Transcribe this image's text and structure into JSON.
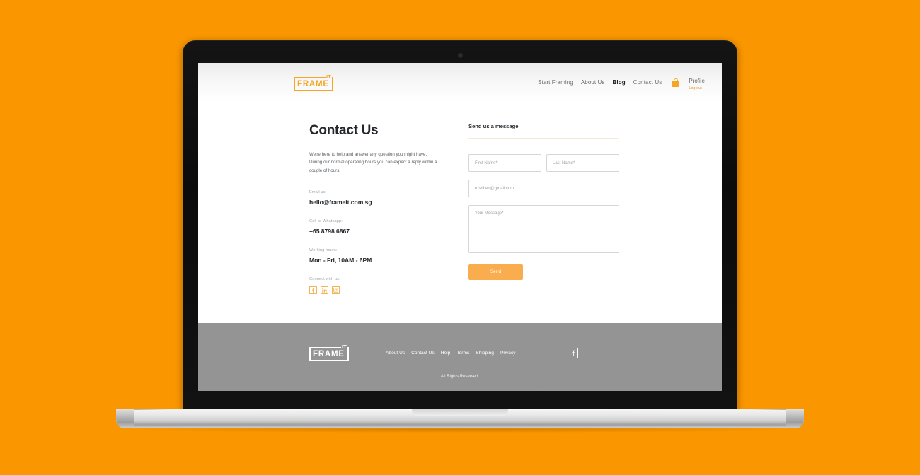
{
  "header": {
    "logo": {
      "word": "FRAME",
      "superscript": "IT"
    },
    "nav": [
      {
        "label": "Start Framing",
        "active": false
      },
      {
        "label": "About Us",
        "active": false
      },
      {
        "label": "Blog",
        "active": true
      },
      {
        "label": "Contact Us",
        "active": false
      }
    ],
    "cart_icon": "shopping-bag-icon",
    "profile": {
      "label": "Profile",
      "logout": "Log out"
    }
  },
  "contact": {
    "title": "Contact Us",
    "intro": "We're here to help and answer any question you might have. During our normal operating hours you can expect a reply within a couple of hours.",
    "email_label": "Email us:",
    "email_value": "hello@frameit.com.sg",
    "phone_label": "Call or Whatsapp:",
    "phone_value": "+65 8798 6867",
    "hours_label": "Working hours:",
    "hours_value": "Mon - Fri, 10AM - 6PM",
    "connect_label": "Connect with us:",
    "socials": [
      {
        "name": "facebook-icon",
        "glyph": "f"
      },
      {
        "name": "linkedin-icon",
        "glyph": "in"
      },
      {
        "name": "instagram-icon",
        "glyph": "▢"
      }
    ]
  },
  "form": {
    "title": "Send us a message",
    "first_name_placeholder": "First Name*",
    "last_name_placeholder": "Last Name*",
    "email_value": "rushben@gmail.com",
    "message_placeholder": "Your Message*",
    "send_label": "Send"
  },
  "footer": {
    "logo": {
      "word": "FRAME",
      "superscript": "IT"
    },
    "links": [
      "About Us",
      "Contact Us",
      "Help",
      "Terms",
      "Shipping",
      "Privacy"
    ],
    "social": {
      "name": "facebook-icon",
      "glyph": "f"
    },
    "copyright": "All Rights Reserved."
  },
  "colors": {
    "background": "#FA9600",
    "brand_orange": "#F5A623",
    "button_orange": "#F9AD4E",
    "footer_gray": "#949494"
  }
}
